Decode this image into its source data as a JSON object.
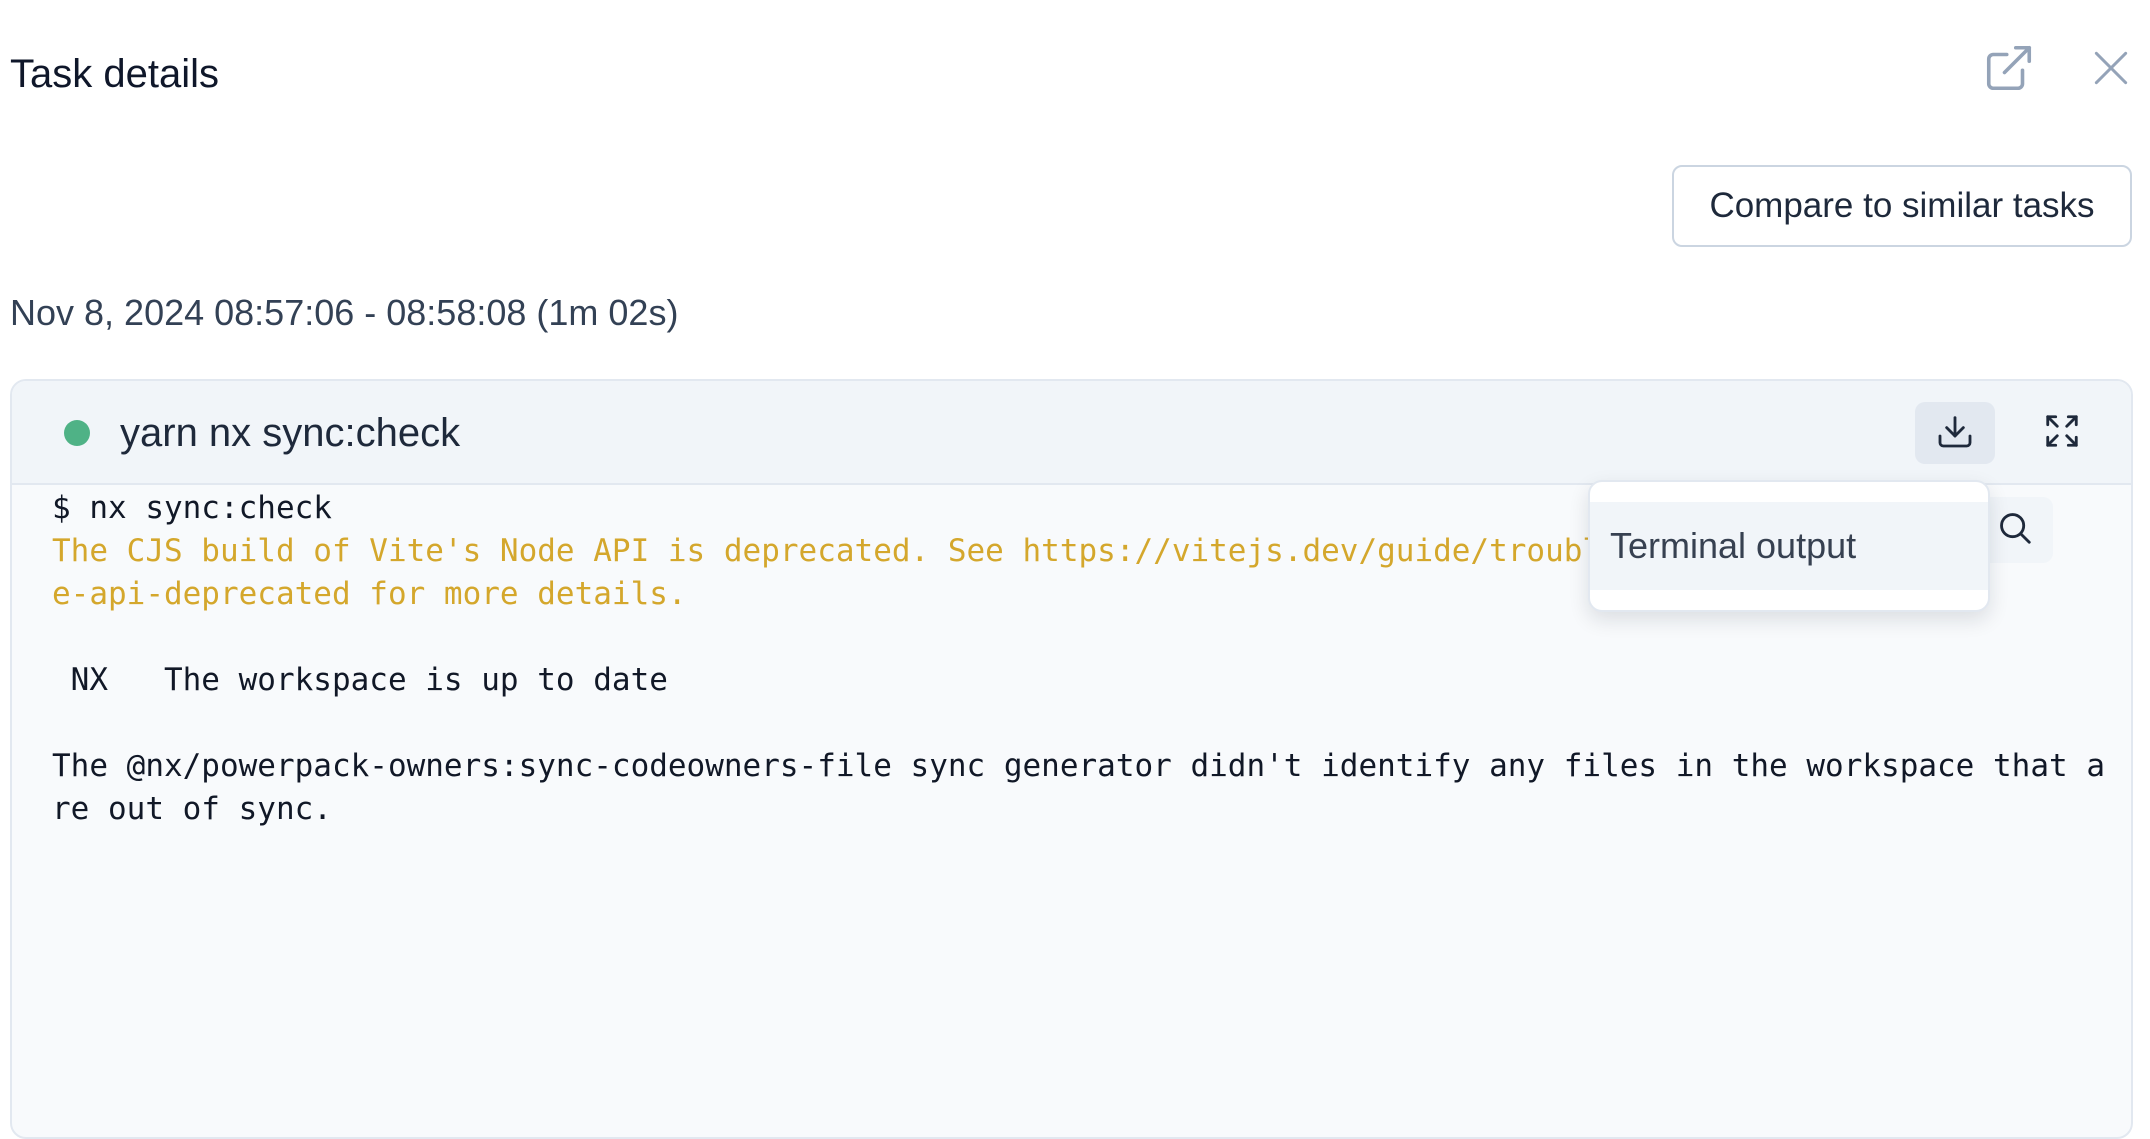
{
  "header": {
    "title": "Task details",
    "open_icon": "external-link-icon",
    "close_icon": "close-icon"
  },
  "actions": {
    "compare_label": "Compare to similar tasks"
  },
  "timing": {
    "text": "Nov 8, 2024 08:57:06 - 08:58:08 (1m 02s)"
  },
  "task": {
    "status": "success",
    "status_color": "#4fb286",
    "command": "yarn nx sync:check",
    "download_icon": "download-icon",
    "fullscreen_icon": "fullscreen-icon",
    "search_icon": "search-icon"
  },
  "terminal": {
    "lines": [
      "$ nx sync:check",
      "The CJS build of Vite's Node API is deprecated. See https://vitejs.dev/guide/troubles",
      "e-api-deprecated for more details.",
      "",
      " NX   The workspace is up to date",
      "",
      "The @nx/powerpack-owners:sync-codeowners-file sync generator didn't identify any files in the workspace that a",
      "re out of sync."
    ],
    "warning_color": "#d4a72c"
  },
  "download_menu": {
    "items": [
      {
        "label": "Terminal output"
      }
    ]
  }
}
